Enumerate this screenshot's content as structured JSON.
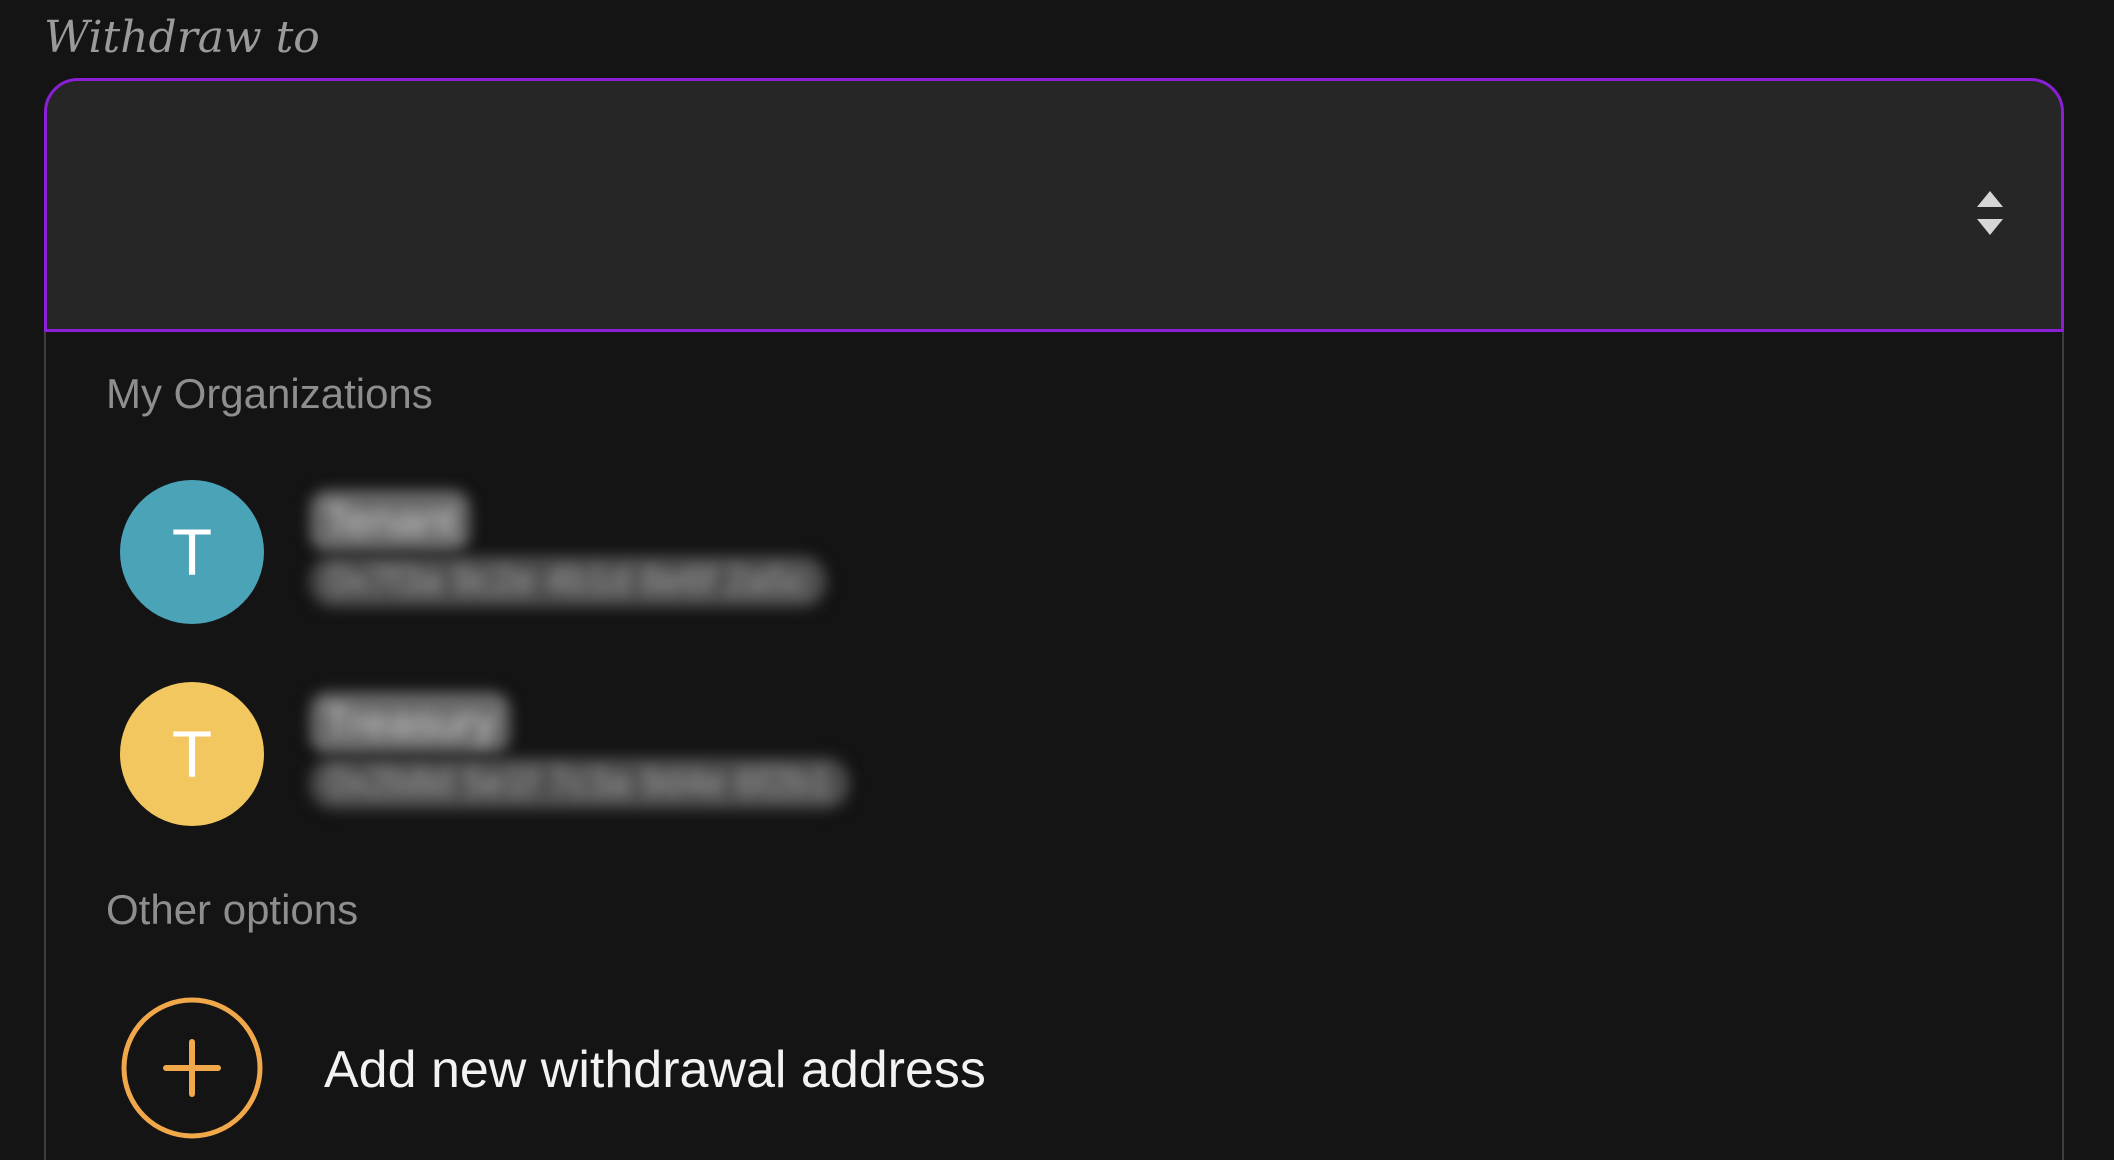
{
  "withdraw_to": {
    "label": "Withdraw to",
    "selected_value": ""
  },
  "dropdown": {
    "organizations_heading": "My Organizations",
    "organizations": [
      {
        "initial": "T",
        "avatar_color": "#4ba3b8",
        "name": "Tenant",
        "detail": "0x7f3a 9c2e 4b1d 8e6f 2a5c"
      },
      {
        "initial": "T",
        "avatar_color": "#f3c75f",
        "name": "Treasury",
        "detail": "0x2b8d 5e1f 7c3a 9d4e 6f2b1"
      }
    ],
    "other_heading": "Other options",
    "add_option": {
      "label": "Add new withdrawal address",
      "icon": "plus-circle-icon",
      "icon_color": "#f0a84a"
    }
  },
  "colors": {
    "focus_border": "#8a1fd6",
    "background": "#141414",
    "field_background": "#262626"
  }
}
